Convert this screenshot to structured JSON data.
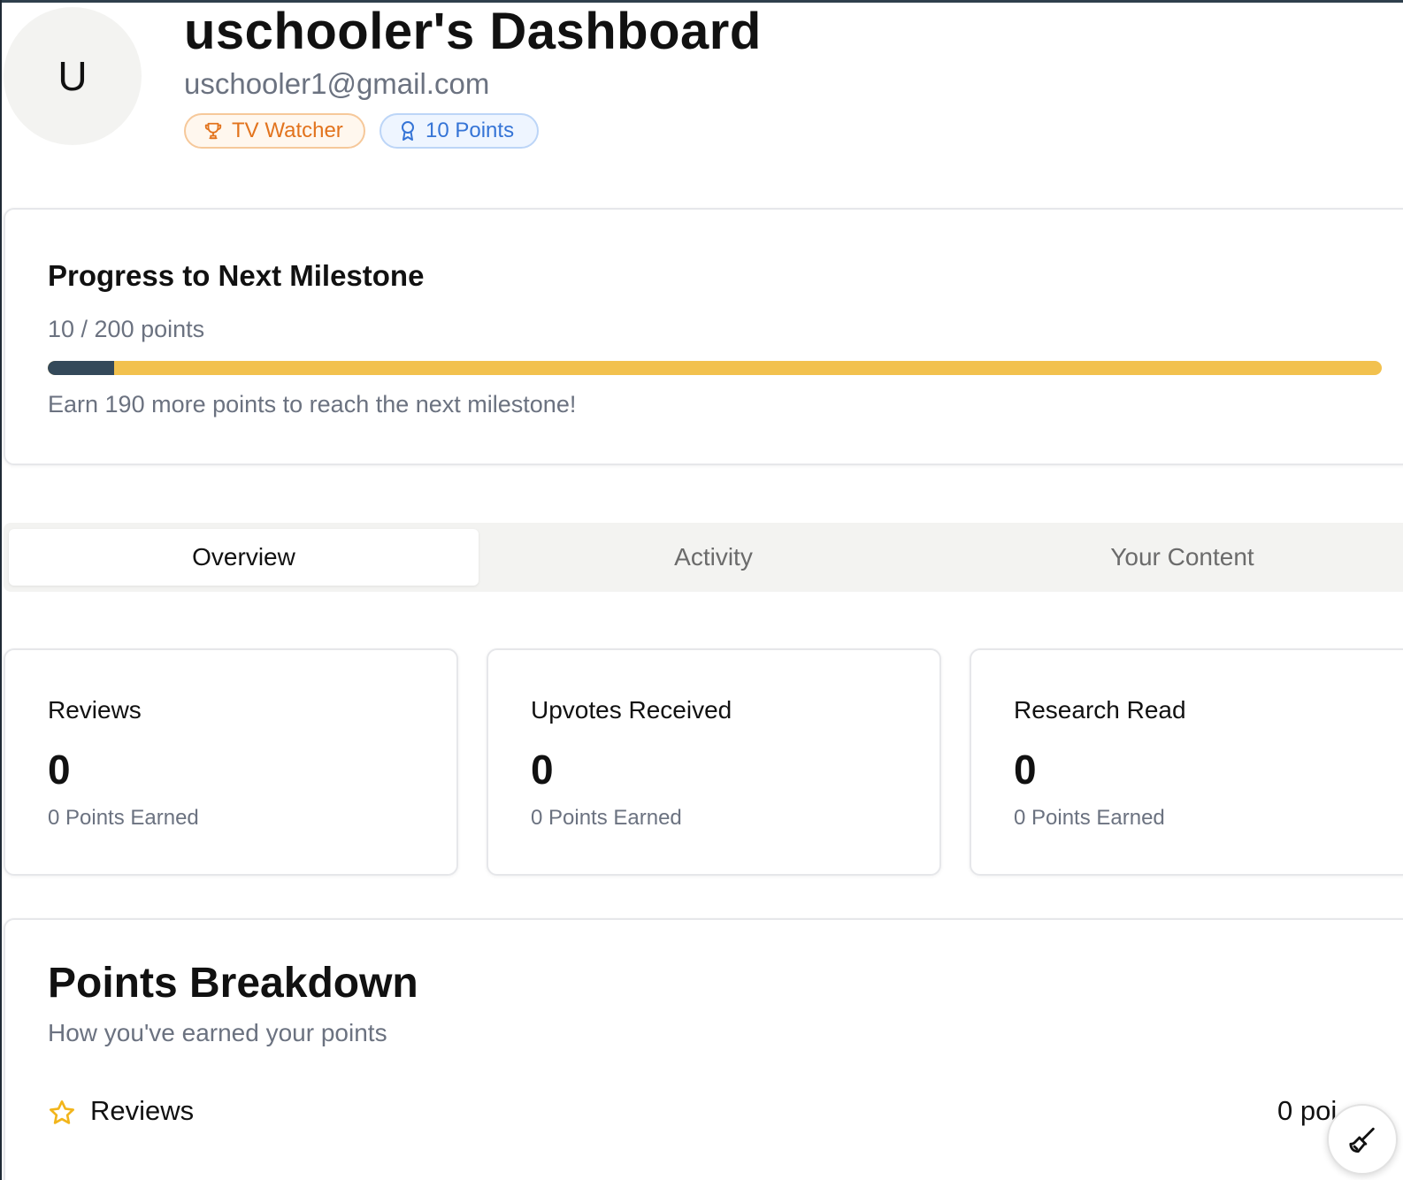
{
  "header": {
    "avatar_letter": "U",
    "title": "uschooler's Dashboard",
    "email": "uschooler1@gmail.com",
    "badges": {
      "title_badge": {
        "label": "TV Watcher",
        "icon": "trophy-icon"
      },
      "points_badge": {
        "label": "10 Points",
        "icon": "award-icon"
      }
    }
  },
  "progress": {
    "title": "Progress to Next Milestone",
    "count_text": "10 / 200 points",
    "current": 10,
    "target": 200,
    "hint": "Earn 190 more points to reach the next milestone!"
  },
  "tabs": [
    {
      "label": "Overview",
      "active": true
    },
    {
      "label": "Activity",
      "active": false
    },
    {
      "label": "Your Content",
      "active": false
    }
  ],
  "stats": [
    {
      "label": "Reviews",
      "value": "0",
      "sub": "0 Points Earned"
    },
    {
      "label": "Upvotes Received",
      "value": "0",
      "sub": "0 Points Earned"
    },
    {
      "label": "Research Read",
      "value": "0",
      "sub": "0 Points Earned"
    }
  ],
  "breakdown": {
    "title": "Points Breakdown",
    "subtitle": "How you've earned your points",
    "rows": [
      {
        "label": "Reviews",
        "points": "0 poi",
        "icon": "star-icon"
      }
    ]
  },
  "colors": {
    "progress_fill": "#34495a",
    "progress_track": "#f2c14e",
    "title_badge": "#e2731d",
    "points_badge": "#3574d6",
    "star": "#f2b51b"
  }
}
